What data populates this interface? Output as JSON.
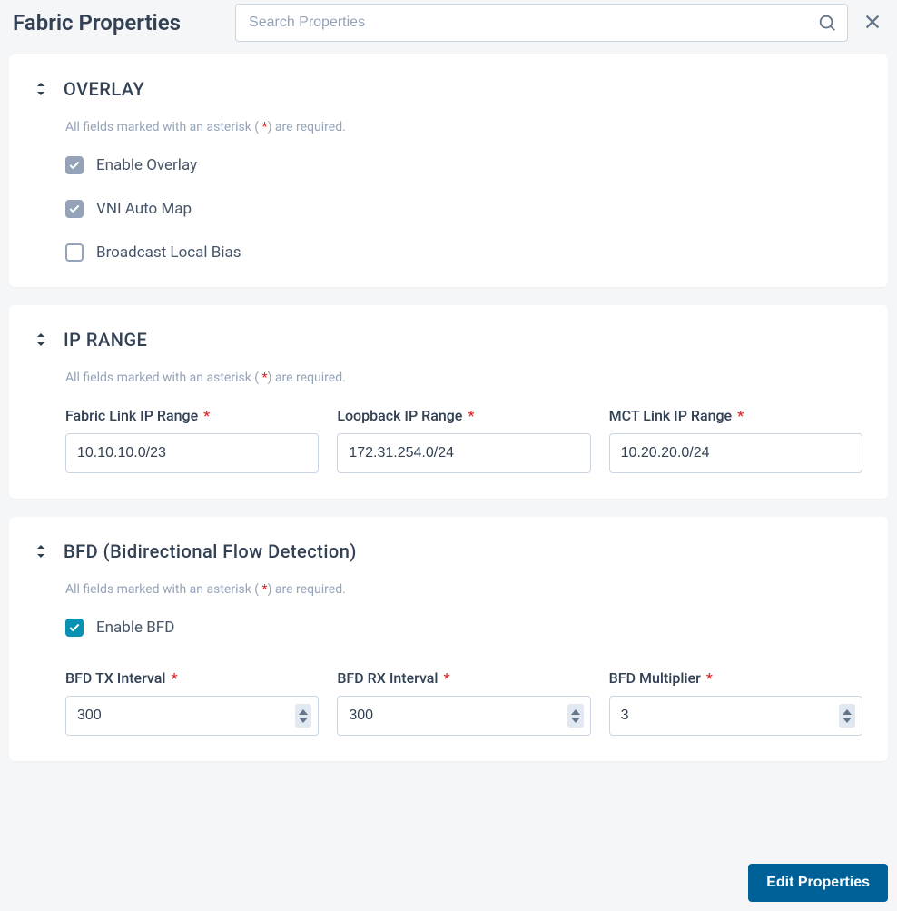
{
  "header": {
    "title": "Fabric Properties",
    "search_placeholder": "Search Properties"
  },
  "required_note_prefix": "All fields marked with an asterisk ( ",
  "required_note_asterisk": "*",
  "required_note_suffix": ") are required.",
  "overlay": {
    "title": "OVERLAY",
    "enable_overlay_label": "Enable Overlay",
    "vni_auto_map_label": "VNI Auto Map",
    "broadcast_local_bias_label": "Broadcast Local Bias",
    "enable_overlay_checked": true,
    "vni_auto_map_checked": true,
    "broadcast_local_bias_checked": false
  },
  "ip_range": {
    "title": "IP RANGE",
    "fabric_link_label": "Fabric Link IP Range",
    "fabric_link_value": "10.10.10.0/23",
    "loopback_label": "Loopback IP Range",
    "loopback_value": "172.31.254.0/24",
    "mct_link_label": "MCT Link IP Range",
    "mct_link_value": "10.20.20.0/24"
  },
  "bfd": {
    "title": "BFD (Bidirectional Flow Detection)",
    "enable_bfd_label": "Enable BFD",
    "enable_bfd_checked": true,
    "tx_interval_label": "BFD TX Interval",
    "tx_interval_value": "300",
    "rx_interval_label": "BFD RX Interval",
    "rx_interval_value": "300",
    "multiplier_label": "BFD Multiplier",
    "multiplier_value": "3"
  },
  "footer": {
    "edit_button_label": "Edit Properties"
  }
}
